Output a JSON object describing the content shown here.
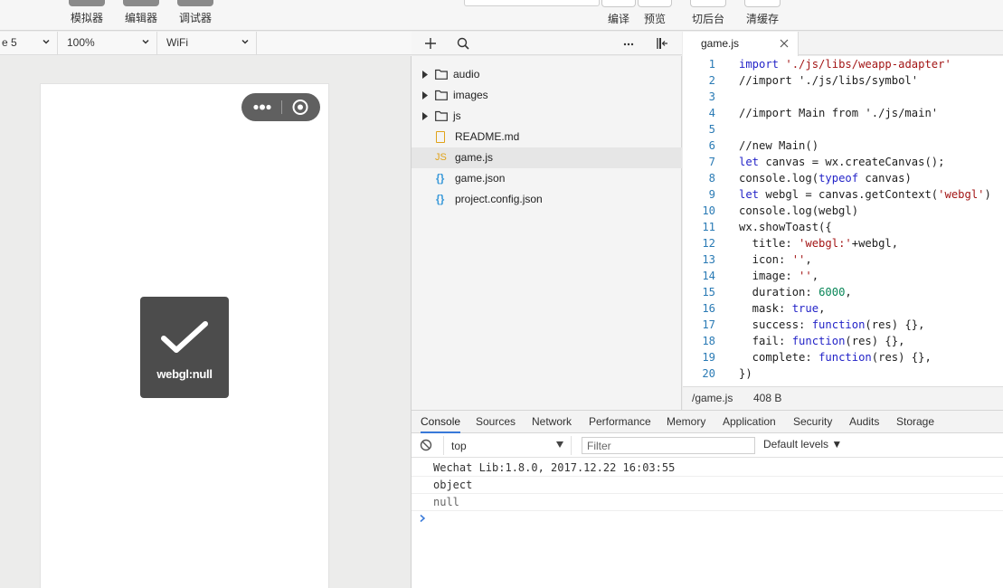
{
  "toolbar": {
    "simulator_label": "模拟器",
    "editor_label": "编辑器",
    "debugger_label": "调试器",
    "compile_label": "编译",
    "preview_label": "预览",
    "background_label": "切后台",
    "clear_cache_label": "清缓存"
  },
  "simbar": {
    "device_value": "e 5",
    "zoom_value": "100%",
    "network_value": "WiFi"
  },
  "toast": {
    "text": "webgl:null"
  },
  "file_tree": {
    "items": [
      {
        "name": "audio",
        "type": "folder"
      },
      {
        "name": "images",
        "type": "folder"
      },
      {
        "name": "js",
        "type": "folder"
      },
      {
        "name": "README.md",
        "type": "md"
      },
      {
        "name": "game.js",
        "type": "js",
        "selected": true
      },
      {
        "name": "game.json",
        "type": "json"
      },
      {
        "name": "project.config.json",
        "type": "json"
      }
    ],
    "js_badge": "JS",
    "json_badge": "{}"
  },
  "editor": {
    "tab_label": "game.js",
    "line_numbers": [
      "1",
      "2",
      "3",
      "4",
      "5",
      "6",
      "7",
      "8",
      "9",
      "10",
      "11",
      "12",
      "13",
      "14",
      "15",
      "16",
      "17",
      "18",
      "19",
      "20"
    ],
    "code_lines": [
      "import './js/libs/weapp-adapter'",
      "//import './js/libs/symbol'",
      "",
      "//import Main from './js/main'",
      "",
      "//new Main()",
      "let canvas = wx.createCanvas();",
      "console.log(typeof canvas)",
      "let webgl = canvas.getContext('webgl')",
      "console.log(webgl)",
      "wx.showToast({",
      "  title: 'webgl:'+webgl,",
      "  icon: '',",
      "  image: '',",
      "  duration: 6000,",
      "  mask: true,",
      "  success: function(res) {},",
      "  fail: function(res) {},",
      "  complete: function(res) {},",
      "})"
    ]
  },
  "statusbar": {
    "path": "/game.js",
    "size": "408 B"
  },
  "devtools": {
    "tabs": [
      "Console",
      "Sources",
      "Network",
      "Performance",
      "Memory",
      "Application",
      "Security",
      "Audits",
      "Storage"
    ],
    "context": "top",
    "filter_placeholder": "Filter",
    "levels": "Default levels ▼",
    "logs": [
      "Wechat Lib:1.8.0, 2017.12.22 16:03:55",
      "object",
      "null"
    ]
  },
  "colors": {
    "accent": "#3879d9",
    "keyword": "#2424c8",
    "string": "#a31515",
    "comment": "#118a11",
    "number": "#098658",
    "toast_bg": "#4c4c4c"
  }
}
